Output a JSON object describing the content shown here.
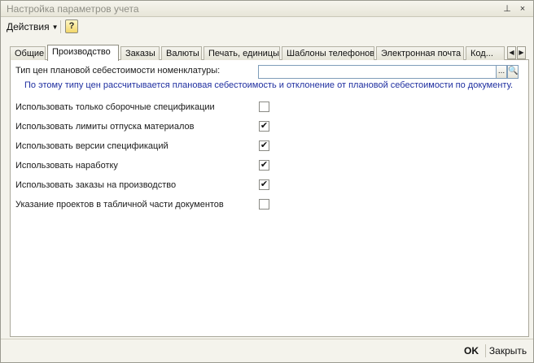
{
  "window": {
    "title": "Настройка параметров учета",
    "pin_glyph": "⊥",
    "close_glyph": "×"
  },
  "toolbar": {
    "actions_label": "Действия",
    "actions_caret": "▼",
    "help_label": "?"
  },
  "tabs": [
    {
      "label": "Общие"
    },
    {
      "label": "Производство",
      "active": true
    },
    {
      "label": "Заказы"
    },
    {
      "label": "Валюты"
    },
    {
      "label": "Печать, единицы"
    },
    {
      "label": "Шаблоны телефонов"
    },
    {
      "label": "Электронная почта"
    },
    {
      "label": "Код..."
    }
  ],
  "tab_scroll": {
    "left_glyph": "◀",
    "right_glyph": "▶"
  },
  "production": {
    "price_type_label": "Тип цен плановой себестоимости номенклатуры:",
    "price_type_value": "",
    "select_button_label": "...",
    "open_button_label": "🔍",
    "hint": "По этому типу цен рассчитывается плановая себестоимость и отклонение от плановой себестоимости по документу.",
    "options": [
      {
        "label": "Использовать только сборочные спецификации",
        "checked": false
      },
      {
        "label": "Использовать лимиты отпуска материалов",
        "checked": true
      },
      {
        "label": "Использовать версии спецификаций",
        "checked": true
      },
      {
        "label": "Использовать наработку",
        "checked": true
      },
      {
        "label": "Использовать заказы на производство",
        "checked": true
      },
      {
        "label": "Указание проектов в табличной части документов",
        "checked": false
      }
    ],
    "check_glyph": "✔"
  },
  "footer": {
    "ok_label": "OK",
    "close_label": "Закрыть"
  }
}
